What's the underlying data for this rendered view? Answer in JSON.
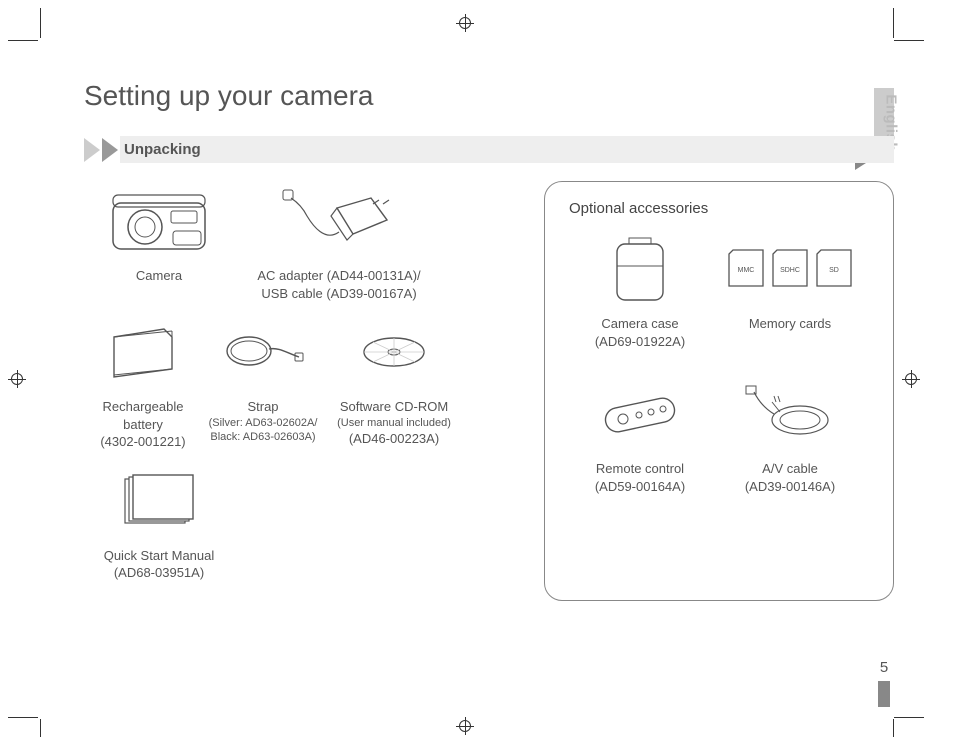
{
  "page_title": "Setting up your camera",
  "section_heading": "Unpacking",
  "language_tab": "English",
  "page_number": "5",
  "items": {
    "camera": "Camera",
    "ac_adapter_l1": "AC adapter (AD44-00131A)/",
    "ac_adapter_l2": "USB cable (AD39-00167A)",
    "battery_l1": "Rechargeable",
    "battery_l2": "battery",
    "battery_l3": "(4302-001221)",
    "strap_l1": "Strap",
    "strap_l2": "(Silver: AD63-02602A/",
    "strap_l3": "Black: AD63-02603A)",
    "cdrom_l1": "Software CD-ROM",
    "cdrom_l2": "(User manual included)",
    "cdrom_l3": "(AD46-00223A)",
    "qsm_l1": "Quick Start Manual",
    "qsm_l2": "(AD68-03951A)"
  },
  "optional": {
    "heading": "Optional accessories",
    "case_l1": "Camera case",
    "case_l2": "(AD69-01922A)",
    "cards": "Memory cards",
    "card_labels": {
      "mmc": "MMC",
      "sdhc": "SDHC",
      "sd": "SD"
    },
    "remote_l1": "Remote control",
    "remote_l2": "(AD59-00164A)",
    "av_l1": "A/V cable",
    "av_l2": "(AD39-00146A)"
  }
}
